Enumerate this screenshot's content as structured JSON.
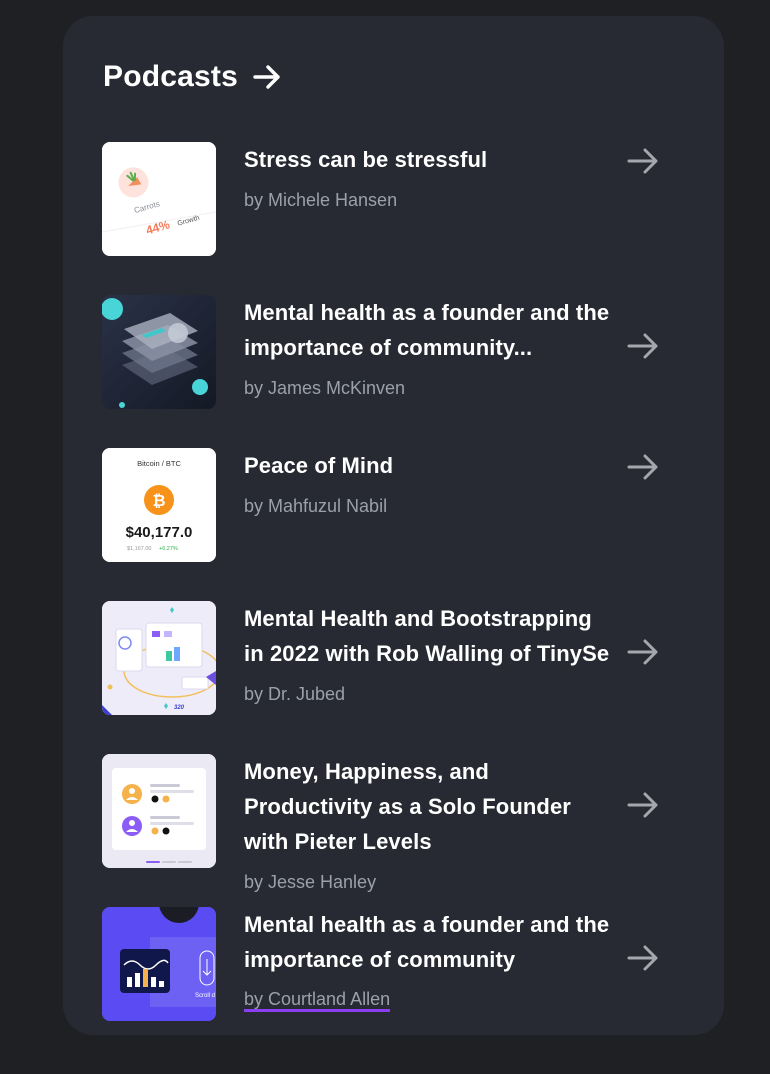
{
  "header": {
    "title": "Podcasts"
  },
  "podcasts": [
    {
      "title": "Stress can be stressful",
      "author": "by Michele Hansen",
      "thumb": {
        "label": "Carrots",
        "stat": "44%",
        "stat_label": "Growth"
      }
    },
    {
      "title": "Mental health as a founder and the importance of community...",
      "author": "by James McKinven"
    },
    {
      "title": "Peace of Mind",
      "author": "by Mahfuzul Nabil",
      "thumb": {
        "label": "Bitcoin / BTC",
        "price": "$40,177.0",
        "sub": "$1,167.00",
        "change": "+6.27%"
      }
    },
    {
      "title": "Mental Health and Bootstrapping in 2022 with Rob Walling of TinySe",
      "author": "by Dr. Jubed",
      "thumb": {
        "badge": "320"
      }
    },
    {
      "title": "Money, Happiness, and Productivity as a Solo Founder with Pieter Levels",
      "author": "by Jesse Hanley"
    },
    {
      "title": "Mental health as a founder and the importance of community",
      "author": "by Courtland Allen",
      "thumb": {
        "label": "Scroll d"
      }
    }
  ],
  "colors": {
    "background": "#1f2023",
    "card": "#272a32",
    "accent": "#8b3ff0",
    "arrow": "#a4a7ae"
  },
  "icons": {
    "header": "arrow-right-icon",
    "row": "arrow-right-icon"
  }
}
